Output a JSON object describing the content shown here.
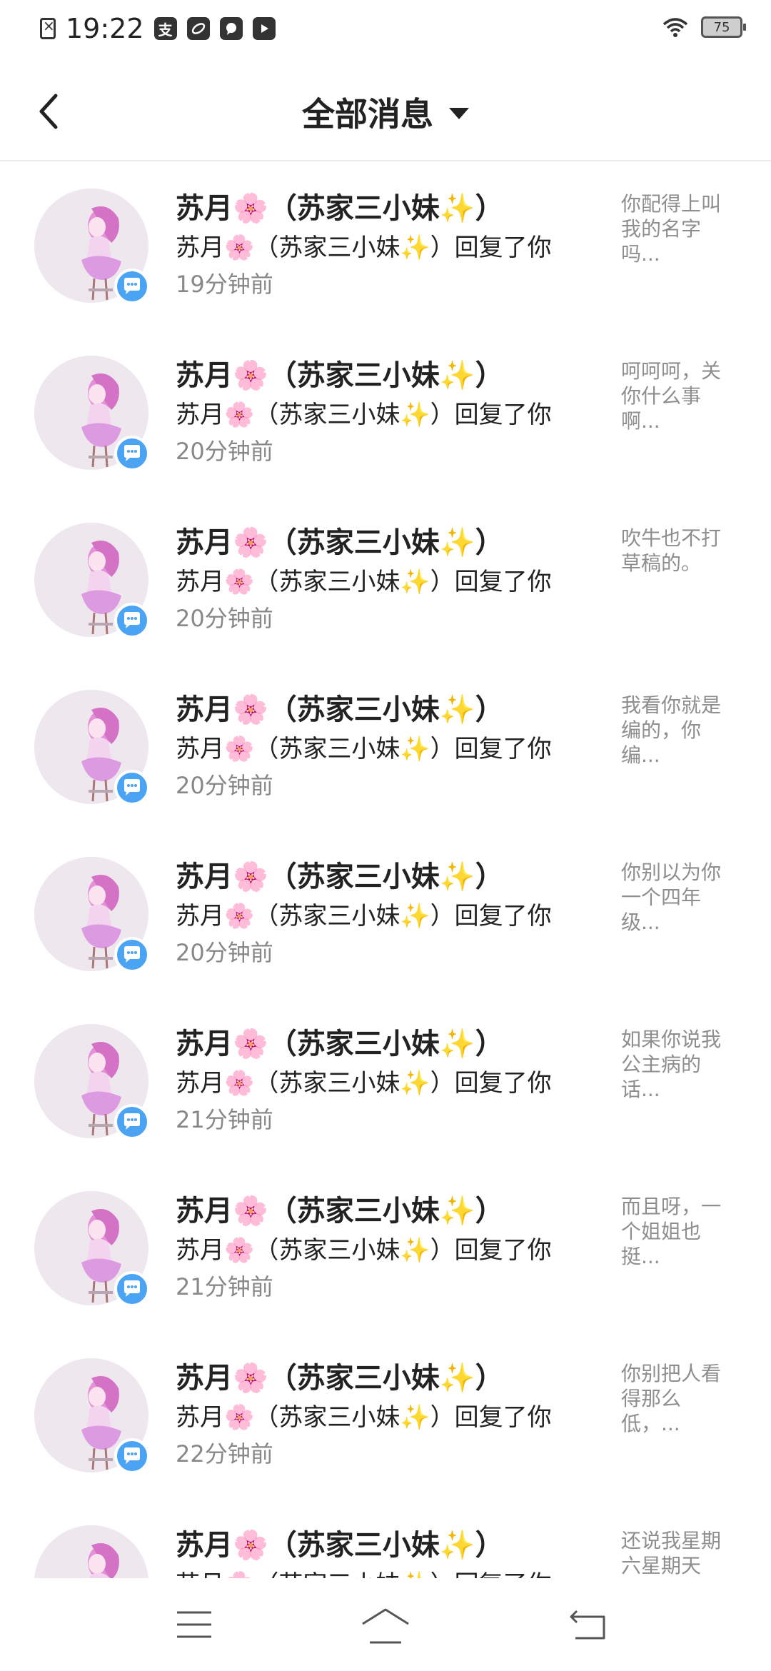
{
  "status_bar": {
    "time": "19:22",
    "battery": "75",
    "app_icons": [
      "alipay-icon",
      "leaf-icon",
      "chat-bubble-icon",
      "play-icon"
    ]
  },
  "header": {
    "title": "全部消息"
  },
  "messages": [
    {
      "name": "苏月🌸（苏家三小妹✨）",
      "action": "苏月🌸（苏家三小妹✨）回复了你",
      "time": "19分钟前",
      "preview": "你配得上叫我的名字吗..."
    },
    {
      "name": "苏月🌸（苏家三小妹✨）",
      "action": "苏月🌸（苏家三小妹✨）回复了你",
      "time": "20分钟前",
      "preview": "呵呵呵，关你什么事啊..."
    },
    {
      "name": "苏月🌸（苏家三小妹✨）",
      "action": "苏月🌸（苏家三小妹✨）回复了你",
      "time": "20分钟前",
      "preview": "吹牛也不打草稿的。"
    },
    {
      "name": "苏月🌸（苏家三小妹✨）",
      "action": "苏月🌸（苏家三小妹✨）回复了你",
      "time": "20分钟前",
      "preview": "我看你就是编的，你编..."
    },
    {
      "name": "苏月🌸（苏家三小妹✨）",
      "action": "苏月🌸（苏家三小妹✨）回复了你",
      "time": "20分钟前",
      "preview": "你别以为你一个四年级..."
    },
    {
      "name": "苏月🌸（苏家三小妹✨）",
      "action": "苏月🌸（苏家三小妹✨）回复了你",
      "time": "21分钟前",
      "preview": "如果你说我公主病的话..."
    },
    {
      "name": "苏月🌸（苏家三小妹✨）",
      "action": "苏月🌸（苏家三小妹✨）回复了你",
      "time": "21分钟前",
      "preview": "而且呀，一个姐姐也挺..."
    },
    {
      "name": "苏月🌸（苏家三小妹✨）",
      "action": "苏月🌸（苏家三小妹✨）回复了你",
      "time": "22分钟前",
      "preview": "你别把人看得那么低，..."
    },
    {
      "name": "苏月🌸（苏家三小妹✨）",
      "action": "苏月🌸（苏家三小妹✨）回复了你",
      "time": "",
      "preview": "还说我星期六星期天"
    }
  ],
  "navbar": {
    "buttons": [
      "menu-icon",
      "home-icon",
      "back-nav-icon"
    ]
  }
}
